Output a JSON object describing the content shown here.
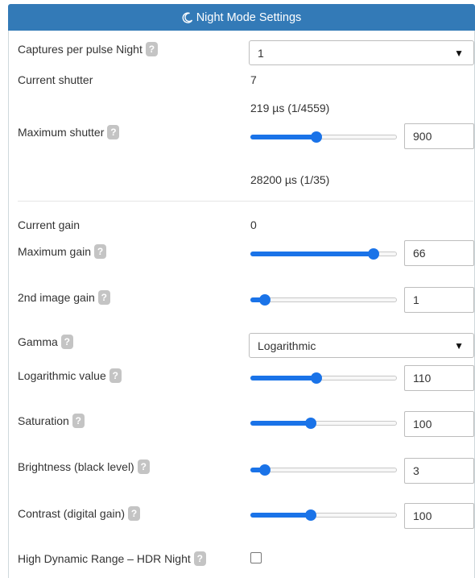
{
  "header": {
    "title": "Night Mode Settings",
    "icon": "moon-icon"
  },
  "settings": {
    "captures_per_pulse": {
      "label": "Captures per pulse Night",
      "value": "1"
    },
    "current_shutter": {
      "label": "Current shutter",
      "value": "7",
      "detail": "219 µs (1/4559)"
    },
    "maximum_shutter": {
      "label": "Maximum shutter",
      "value": "900",
      "slider_fraction": 0.45,
      "detail": "28200 µs (1/35)"
    },
    "current_gain": {
      "label": "Current gain",
      "value": "0"
    },
    "maximum_gain": {
      "label": "Maximum gain",
      "value": "66",
      "slider_fraction": 0.84
    },
    "second_image_gain": {
      "label": "2nd image gain",
      "value": "1",
      "slider_fraction": 0.1
    },
    "gamma": {
      "label": "Gamma",
      "value": "Logarithmic"
    },
    "logarithmic_value": {
      "label": "Logarithmic value",
      "value": "110",
      "slider_fraction": 0.45
    },
    "saturation": {
      "label": "Saturation",
      "value": "100",
      "slider_fraction": 0.41
    },
    "brightness": {
      "label": "Brightness (black level)",
      "value": "3",
      "slider_fraction": 0.1
    },
    "contrast": {
      "label": "Contrast (digital gain)",
      "value": "100",
      "slider_fraction": 0.41
    },
    "hdr": {
      "label": "High Dynamic Range – HDR Night",
      "checked": false
    }
  },
  "help_glyph": "?",
  "select_caret": "▼",
  "colors": {
    "header": "#337ab7",
    "accent": "#1a73e8",
    "help_badge": "#c4c4c4"
  }
}
